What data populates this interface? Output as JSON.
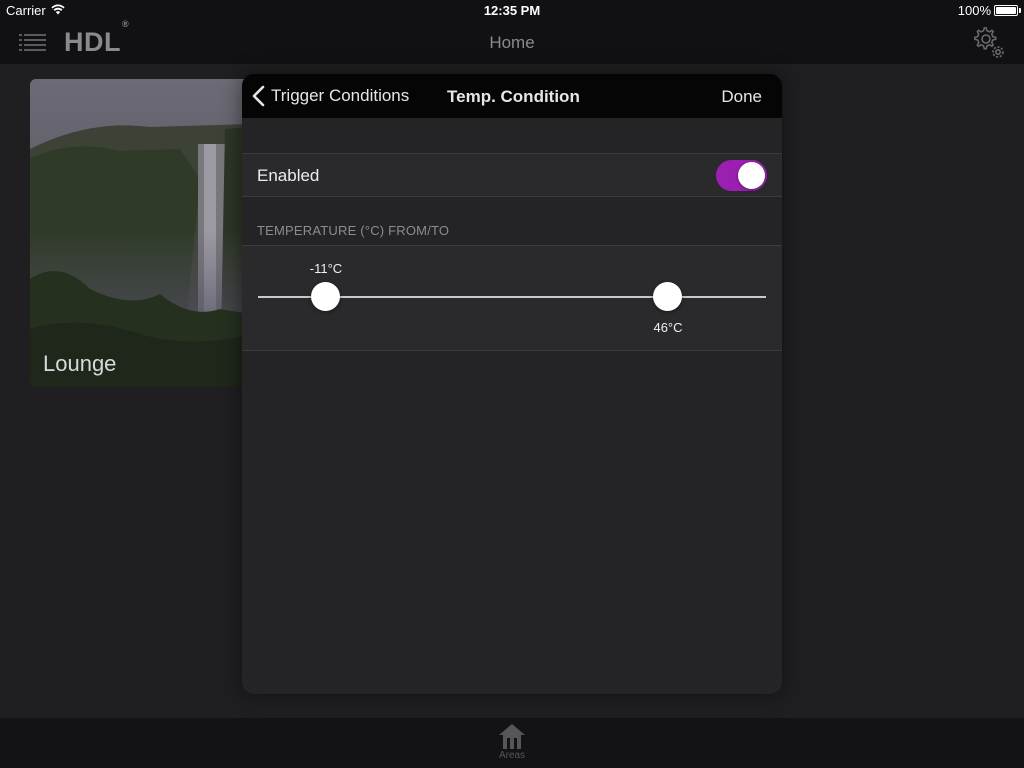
{
  "status_bar": {
    "carrier": "Carrier",
    "time": "12:35 PM",
    "battery": "100%"
  },
  "nav": {
    "logo": "HDL",
    "logo_mark": "®",
    "title": "Home",
    "menu_icon": "list-icon",
    "settings_icon": "gears-icon"
  },
  "areas": [
    {
      "label": "Lounge"
    }
  ],
  "tab_bar": {
    "items": [
      {
        "label": "Areas",
        "icon": "house-icon"
      }
    ]
  },
  "modal": {
    "back_label": "Trigger Conditions",
    "title": "Temp. Condition",
    "done_label": "Done",
    "enabled_label": "Enabled",
    "enabled_value": true,
    "section_header": "TEMPERATURE (°C) FROM/TO",
    "range": {
      "from_label": "-11°C",
      "to_label": "46°C"
    }
  },
  "colors": {
    "accent": "#9b1fb1",
    "background": "#1f1f21",
    "bar": "#111113"
  }
}
